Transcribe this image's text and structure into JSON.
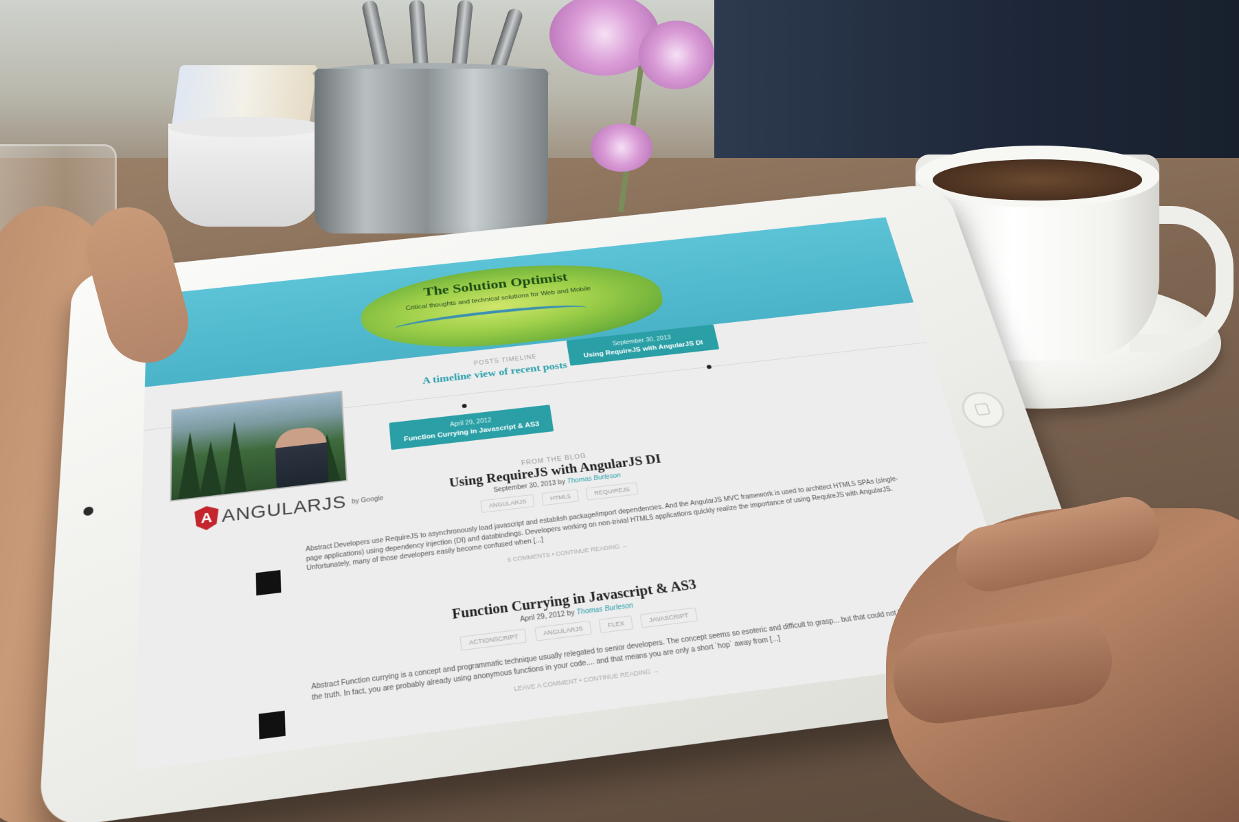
{
  "site": {
    "title": "The Solution Optimist",
    "subtitle": "Critical thoughts and technical solutions for Web and Mobile"
  },
  "timeline": {
    "label": "POSTS TIMELINE",
    "title": "A timeline view of recent posts",
    "cards": [
      {
        "date": "April 29, 2012",
        "title": "Function Currying in Javascript & AS3"
      },
      {
        "date": "September 30, 2013",
        "title": "Using RequireJS with AngularJS DI"
      }
    ]
  },
  "logo": {
    "name": "ANGULARJS",
    "by": "by Google"
  },
  "posts": [
    {
      "kicker": "FROM THE BLOG",
      "title": "Using RequireJS with AngularJS DI",
      "date": "September 30, 2013 by",
      "author": "Thomas Burleson",
      "tags": [
        "ANGULARJS",
        "HTML5",
        "REQUIREJS"
      ],
      "excerpt": "Abstract Developers use RequireJS to asynchronously load javascript and establish package/import dependencies. And the AngularJS MVC framework is used to architect HTML5 SPAs (single-page applications) using dependency injection (DI) and databindings. Developers working on non-trivial HTML5 applications quickly realize the importance of using RequireJS with AngularJS. Unfortunately, many of those developers easily become confused when [...]",
      "links": "5 COMMENTS • CONTINUE READING →"
    },
    {
      "title": "Function Currying in Javascript & AS3",
      "date": "April 29, 2012 by",
      "author": "Thomas Burleson",
      "tags": [
        "ACTIONSCRIPT",
        "ANGULARJS",
        "FLEX",
        "JAVASCRIPT"
      ],
      "excerpt": "Abstract Function currying is a concept and programmatic technique usually relegated to senior developers. The concept seems so esoteric and difficult to grasp... but that could not be farther from the truth. In fact, you are probably already using anonymous functions in your code.... and that means you are only a short `hop` away from [...]",
      "links": "LEAVE A COMMENT • CONTINUE READING →"
    }
  ]
}
